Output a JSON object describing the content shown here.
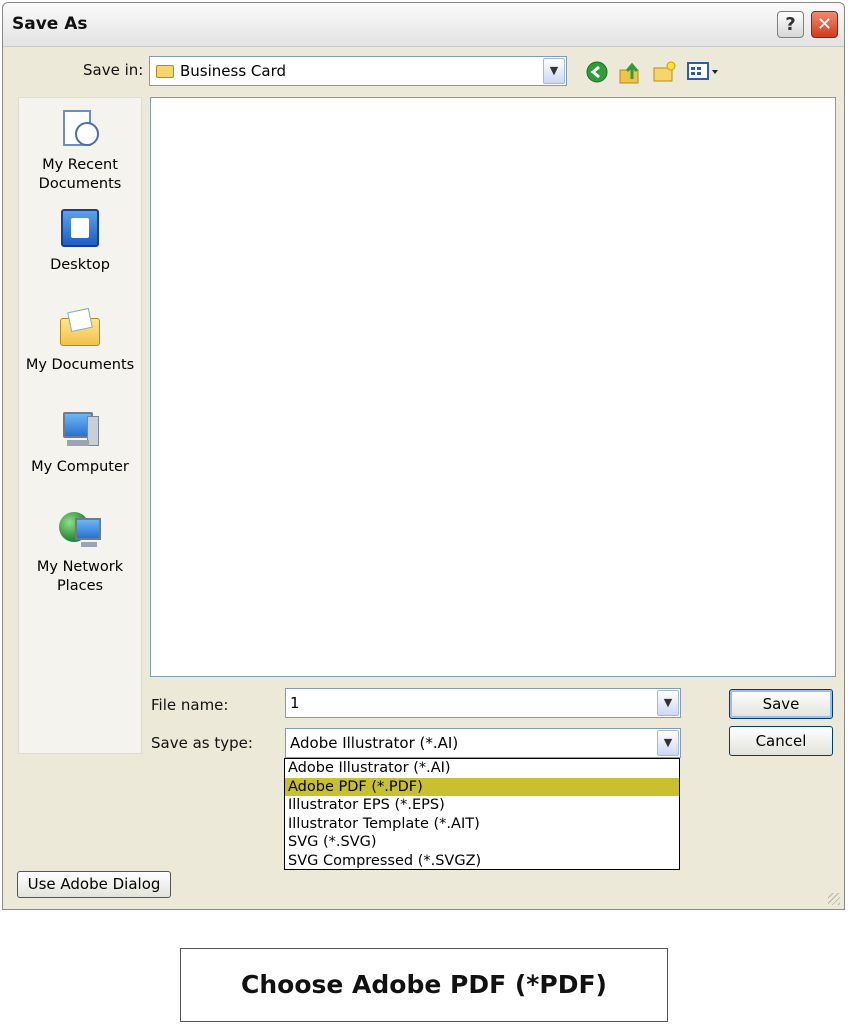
{
  "window": {
    "title": "Save As"
  },
  "titlebar": {
    "help_glyph": "?",
    "close_glyph": "✕"
  },
  "toolbar": {
    "save_in_label": "Save in:",
    "save_in_value": "Business Card",
    "icons": [
      "back-icon",
      "up-folder-icon",
      "new-folder-icon",
      "views-menu-icon"
    ]
  },
  "places": [
    {
      "label": "My Recent Documents",
      "icon": "recent-documents-icon"
    },
    {
      "label": "Desktop",
      "icon": "desktop-icon"
    },
    {
      "label": "My Documents",
      "icon": "my-documents-icon"
    },
    {
      "label": "My Computer",
      "icon": "my-computer-icon"
    },
    {
      "label": "My Network Places",
      "icon": "network-places-icon"
    }
  ],
  "form": {
    "file_name_label": "File name:",
    "file_name_value": "1",
    "save_type_label": "Save as type:",
    "save_type_value": "Adobe Illustrator (*.AI)",
    "save_button": "Save",
    "cancel_button": "Cancel"
  },
  "type_options": [
    "Adobe Illustrator (*.AI)",
    "Adobe PDF (*.PDF)",
    "Illustrator EPS (*.EPS)",
    "Illustrator Template (*.AIT)",
    "SVG (*.SVG)",
    "SVG Compressed (*.SVGZ)"
  ],
  "selected_option_index": 1,
  "footer": {
    "adobe_dialog_button": "Use Adobe Dialog"
  },
  "caption": "Choose Adobe PDF (*PDF)",
  "colors": {
    "highlight": "#c8c02c",
    "close_button": "#d03b1c"
  }
}
